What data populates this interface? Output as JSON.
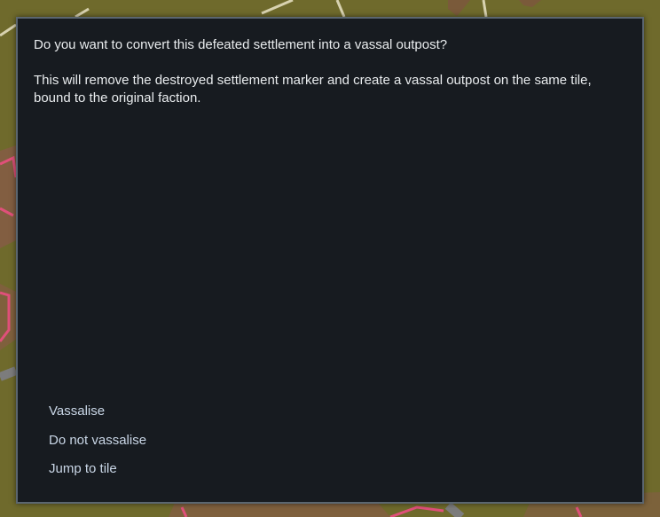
{
  "dialog": {
    "question": "Do you want to convert this defeated settlement into a vassal outpost?",
    "description": "This will remove the destroyed settlement marker and create a vassal outpost on the same tile, bound to the original faction.",
    "options": [
      {
        "label": "Vassalise"
      },
      {
        "label": "Do not vassalise"
      },
      {
        "label": "Jump to tile"
      }
    ]
  },
  "colors": {
    "map_grass": "#6f6a2c",
    "territory_border": "#e0507a",
    "dialog_bg": "#171b20",
    "dialog_border": "#5b6670",
    "option_text": "#c9d6e6"
  }
}
